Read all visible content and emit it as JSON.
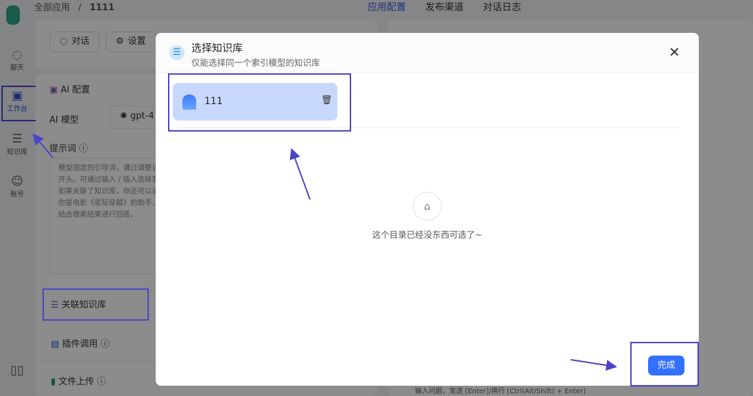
{
  "breadcrumb": {
    "root": "全部应用",
    "sep": "/",
    "current": "1111"
  },
  "top_tabs": [
    {
      "label": "应用配置",
      "active": true
    },
    {
      "label": "发布渠道"
    },
    {
      "label": "对话日志"
    }
  ],
  "sidebar": {
    "items": [
      {
        "label": "聊天",
        "icon": "chat-icon"
      },
      {
        "label": "工作台",
        "icon": "robot-icon",
        "active": true
      },
      {
        "label": "知识库",
        "icon": "database-icon"
      },
      {
        "label": "账号",
        "icon": "user-icon"
      }
    ],
    "bottom_icon": "book-icon"
  },
  "toolbar": {
    "chat": "对话",
    "settings": "设置"
  },
  "config": {
    "section_title": "AI 配置",
    "model_label": "AI 模型",
    "model_value": "gpt-4",
    "prompt_label": "提示词",
    "prompt_lines": [
      "模型固定的引导词，通过调整该",
      "开头。可通过输入 / 插入选择变",
      "如果关联了知识库，你还可以通",
      "你是电影《星际穿越》的助手，",
      "结合搜索结果进行回答。"
    ],
    "kb_label": "关联知识库",
    "plugin_label": "插件调用",
    "file_label": "文件上传"
  },
  "chat_input_placeholder": "输入问题，发送 [Enter]/换行 [Ctrl(Alt/Shift) + Enter]",
  "modal": {
    "title": "选择知识库",
    "subtitle": "仅能选择同一个索引模型的知识库",
    "selected": [
      {
        "name": "111"
      }
    ],
    "empty_text": "这个目录已经没东西可选了~",
    "done": "完成"
  },
  "colors": {
    "primary": "#3370ff",
    "annotation": "#4a44c6",
    "selected_card": "#c8d8fc"
  }
}
